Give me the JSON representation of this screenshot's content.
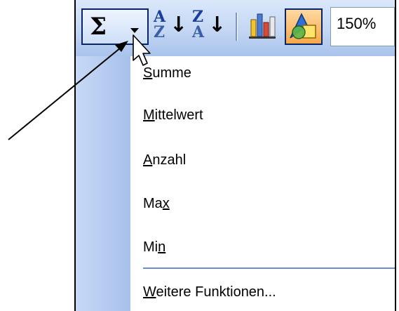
{
  "toolbar": {
    "autosum_symbol": "Σ",
    "sort_ascending": {
      "top": "A",
      "bottom": "Z",
      "arrow": "↓"
    },
    "sort_descending": {
      "top": "Z",
      "bottom": "A",
      "arrow": "↓"
    },
    "zoom_value": "150%",
    "icons": [
      "autosum-icon",
      "dropdown-arrow-icon",
      "sort-ascending-icon",
      "sort-descending-icon",
      "chart-wizard-icon",
      "drawing-icon"
    ]
  },
  "menu": {
    "items": [
      {
        "pre": "",
        "ul": "S",
        "post": "umme"
      },
      {
        "pre": "",
        "ul": "M",
        "post": "ittelwert"
      },
      {
        "pre": "",
        "ul": "A",
        "post": "nzahl"
      },
      {
        "pre": "Ma",
        "ul": "x",
        "post": ""
      },
      {
        "pre": "Mi",
        "ul": "n",
        "post": ""
      },
      {
        "pre": "",
        "ul": "W",
        "post": "eitere Funktionen..."
      }
    ]
  },
  "colors": {
    "toolbar_gradient_top": "#dbe8fb",
    "toolbar_gradient_bottom": "#a9c3ec",
    "menu_gutter": "#b7cdf0",
    "highlight_border": "#0a246a",
    "separator": "#6a8ccb"
  }
}
